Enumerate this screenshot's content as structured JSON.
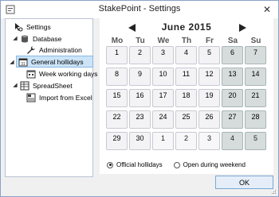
{
  "window": {
    "title": "StakePoint - Settings",
    "close_glyph": "✕"
  },
  "tree": {
    "items": [
      {
        "label": "Settings",
        "icon": "cursor-settings-icon"
      },
      {
        "label": "Database",
        "icon": "database-icon",
        "expander": "◢"
      },
      {
        "label": "Administration",
        "icon": "wrench-icon"
      },
      {
        "label": "General hollidays",
        "icon": "calendar-icon",
        "expander": "◢",
        "selected": true
      },
      {
        "label": "Week working days",
        "icon": "calendar-small-icon"
      },
      {
        "label": "SpreadSheet",
        "icon": "spreadsheet-icon",
        "expander": "◢"
      },
      {
        "label": "Import from Excel",
        "icon": "excel-import-icon"
      }
    ]
  },
  "calendar": {
    "month_label": "June  2015",
    "weekdays": [
      "Mo",
      "Tu",
      "We",
      "Th",
      "Fr",
      "Sa",
      "Su"
    ],
    "weeks": [
      [
        "1",
        "2",
        "3",
        "4",
        "5",
        "6",
        "7"
      ],
      [
        "8",
        "9",
        "10",
        "11",
        "12",
        "13",
        "14"
      ],
      [
        "15",
        "16",
        "17",
        "18",
        "19",
        "20",
        "21"
      ],
      [
        "22",
        "23",
        "24",
        "25",
        "26",
        "27",
        "28"
      ],
      [
        "29",
        "30",
        "1",
        "2",
        "3",
        "4",
        "5"
      ]
    ]
  },
  "options": {
    "official_label": "Official hollidays",
    "open_label": "Open during weekend",
    "selected": "official"
  },
  "buttons": {
    "ok_label": "OK"
  }
}
